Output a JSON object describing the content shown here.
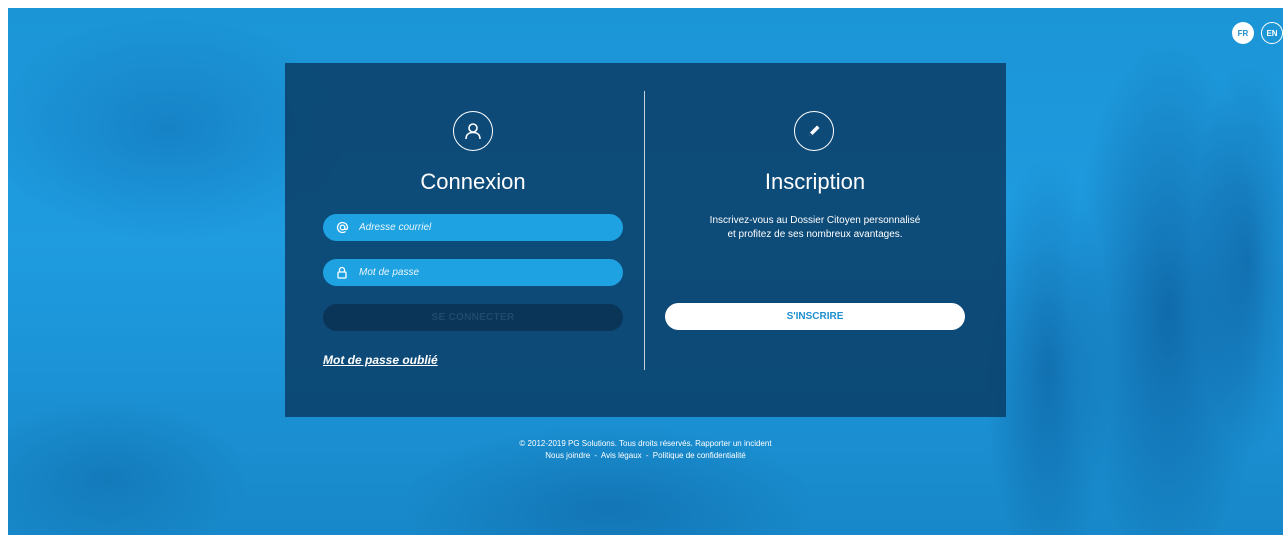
{
  "languages": {
    "fr": "FR",
    "en": "EN"
  },
  "login": {
    "title": "Connexion",
    "email_placeholder": "Adresse courriel",
    "password_placeholder": "Mot de passe",
    "submit_label": "SE CONNECTER",
    "forgot_label": "Mot de passe oublié"
  },
  "signup": {
    "title": "Inscription",
    "description": "Inscrivez-vous au Dossier Citoyen personnalisé et profitez de ses nombreux avantages.",
    "button_label": "S'INSCRIRE"
  },
  "footer": {
    "copyright": "© 2012-2019 PG Solutions. Tous droits réservés.",
    "report_incident": "Rapporter un incident",
    "contact": "Nous joindre",
    "legal": "Avis légaux",
    "privacy": "Politique de confidentialité"
  },
  "icons": {
    "user": "user-icon",
    "pencil": "pencil-icon",
    "at": "at-icon",
    "lock": "lock-icon"
  },
  "colors": {
    "background": "#1f9be0",
    "card": "#0b3e68",
    "field": "#1ea2e2",
    "accent": "#1e8fcf"
  }
}
